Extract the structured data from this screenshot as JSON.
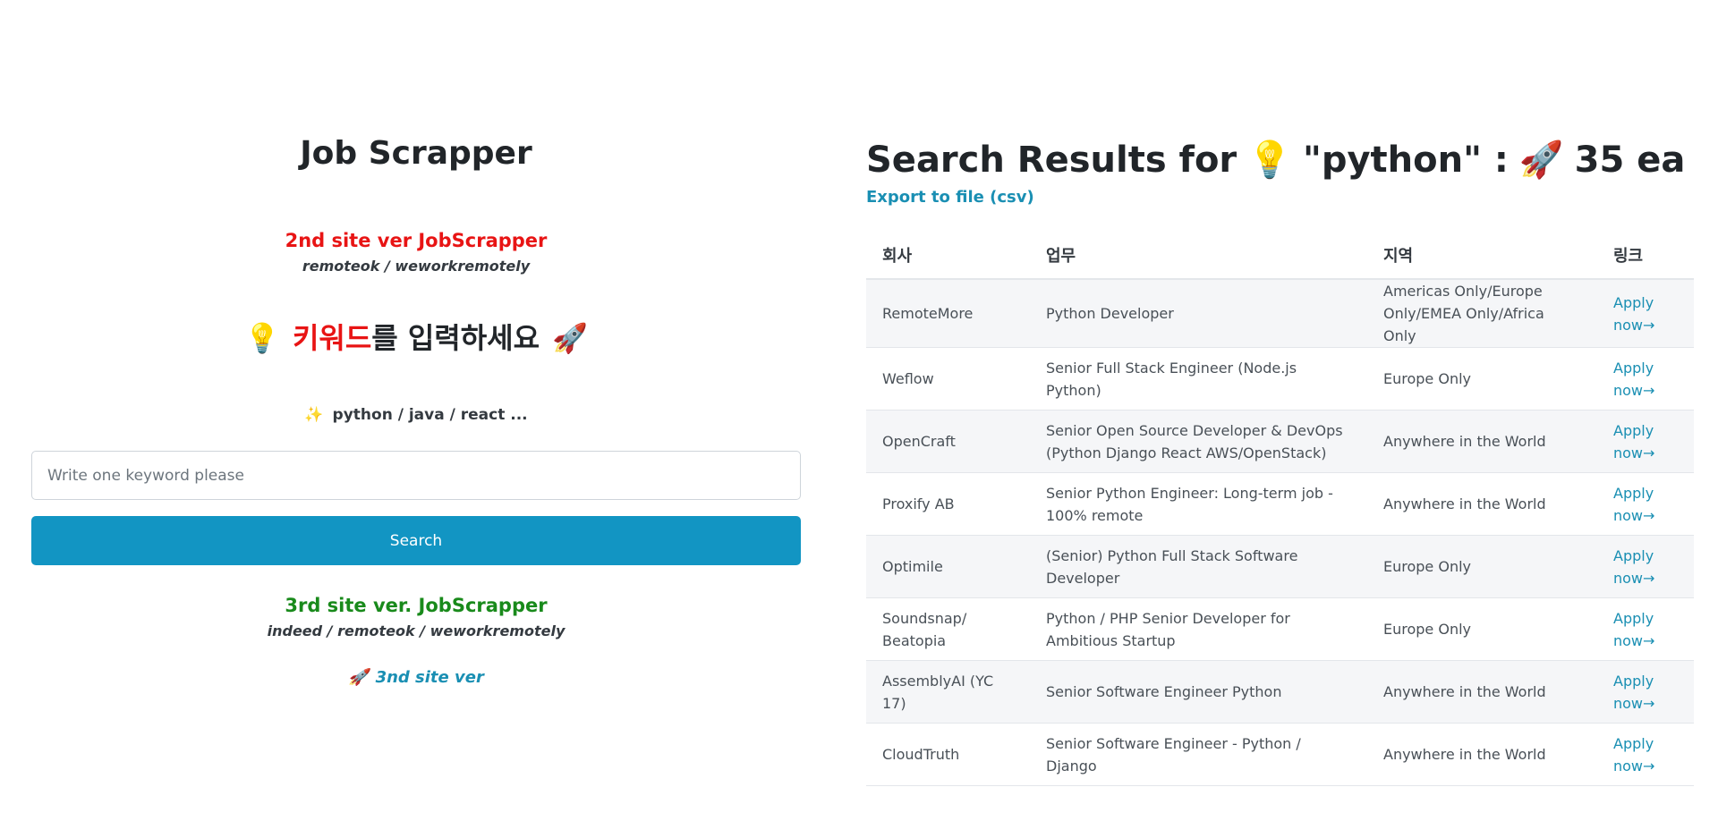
{
  "left": {
    "title": "Job Scrapper",
    "ver2": {
      "title": "2nd site ver JobScrapper",
      "sites": "remoteok / weworkremotely"
    },
    "prompt": {
      "emoji_left": "💡",
      "red_text": "키워드",
      "rest_text": "를 입력하세요",
      "emoji_right": "🚀"
    },
    "examples": {
      "emoji": "✨",
      "text": "python / java / react ..."
    },
    "search": {
      "placeholder": "Write one keyword please",
      "button_label": "Search"
    },
    "ver3": {
      "title": "3rd site ver. JobScrapper",
      "sites": "indeed / remoteok / weworkremotely",
      "link_emoji": "🚀",
      "link_label": "3nd site ver"
    }
  },
  "right": {
    "title_prefix": "Search Results for",
    "title_emoji1": "💡",
    "title_keyword": "\"python\" :",
    "title_emoji2": "🚀",
    "title_count": "35 ea",
    "export_label": "Export to file (csv)",
    "table": {
      "headers": [
        "회사",
        "업무",
        "지역",
        "링크"
      ],
      "rows": [
        {
          "company": "RemoteMore",
          "role": "Python Developer",
          "region": "Americas Only/Europe Only/EMEA Only/Africa Only",
          "link": "Apply now→"
        },
        {
          "company": "Weflow",
          "role": "Senior Full Stack Engineer (Node.js Python)",
          "region": "Europe Only",
          "link": "Apply now→"
        },
        {
          "company": "OpenCraft",
          "role": "Senior Open Source Developer & DevOps (Python Django React AWS/OpenStack)",
          "region": "Anywhere in the World",
          "link": "Apply now→"
        },
        {
          "company": "Proxify AB",
          "role": "Senior Python Engineer: Long-term job - 100% remote",
          "region": "Anywhere in the World",
          "link": "Apply now→"
        },
        {
          "company": "Optimile",
          "role": "(Senior) Python Full Stack Software Developer",
          "region": "Europe Only",
          "link": "Apply now→"
        },
        {
          "company": "Soundsnap/ Beatopia",
          "role": "Python / PHP Senior Developer for Ambitious Startup",
          "region": "Europe Only",
          "link": "Apply now→"
        },
        {
          "company": "AssemblyAI (YC 17)",
          "role": "Senior Software Engineer Python",
          "region": "Anywhere in the World",
          "link": "Apply now→"
        },
        {
          "company": "CloudTruth",
          "role": "Senior Software Engineer - Python / Django",
          "region": "Anywhere in the World",
          "link": "Apply now→"
        }
      ]
    }
  }
}
